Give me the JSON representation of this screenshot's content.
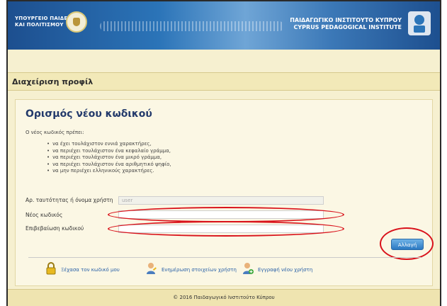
{
  "header": {
    "ministry_line1": "ΥΠΟΥΡΓΕΙΟ ΠΑΙΔΕΙΑΣ",
    "ministry_line2": "ΚΑΙ ΠΟΛΙΤΙΣΜΟΥ",
    "institute_line1": "ΠΑΙΔΑΓΩΓΙΚΟ ΙΝΣΤΙΤΟΥΤΟ ΚΥΠΡΟΥ",
    "institute_line2": "CYPRUS PEDAGOGICAL INSTITUTE"
  },
  "page": {
    "title": "Διαχείριση προφίλ"
  },
  "form": {
    "heading": "Ορισμός νέου κωδικού",
    "intro": "Ο νέος κωδικός πρέπει:",
    "rules": [
      "να έχει τουλάχιστον εννιά χαρακτήρες,",
      "να περιέχει τουλάχιστον ένα κεφαλαίο γράμμα,",
      "να περιέχει τουλάχιστον ένα μικρό γράμμα,",
      "να περιέχει τουλάχιστον ένα αριθμητικό ψηφίο,",
      "να μην περιέχει ελληνικούς χαρακτήρες."
    ],
    "username_label": "Αρ. ταυτότητας ή όνομα χρήστη",
    "username_value": "user",
    "new_password_label": "Νέος κωδικός",
    "new_password_value": "",
    "confirm_label": "Επιβεβαίωση κωδικού",
    "confirm_value": "",
    "submit_label": "Αλλαγή"
  },
  "links": {
    "forgot": "Ξέχασα τον κωδικό μου",
    "update": "Ενημέρωση στοιχείων χρήστη",
    "register": "Εγγραφή νέου χρήστη"
  },
  "footer": {
    "text": "© 2016 Παιδαγωγικό Ινστιτούτο Κύπρου"
  },
  "colors": {
    "annotation": "#d9121b",
    "button": "#2b79c2",
    "link": "#2b62a8"
  },
  "icons": [
    "cyprus-crest-icon",
    "institute-logo-icon",
    "lock-icon",
    "user-edit-icon",
    "user-add-icon"
  ]
}
